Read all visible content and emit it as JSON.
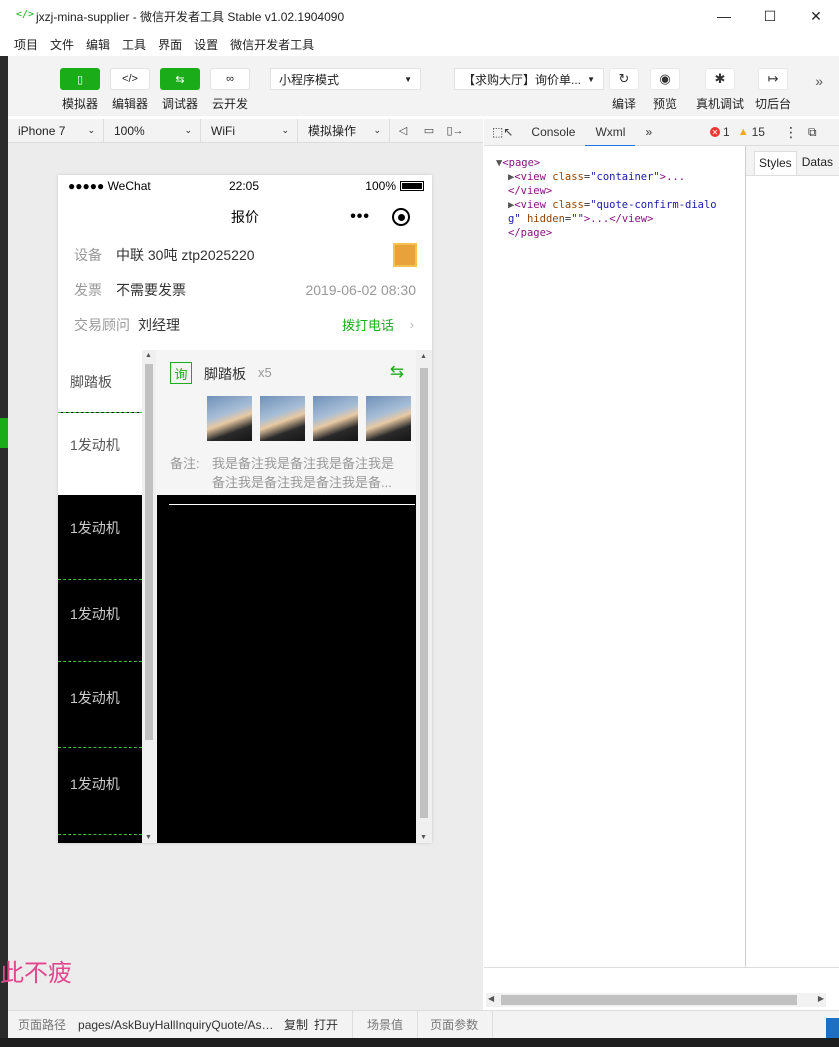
{
  "window": {
    "title": "jxzj-mina-supplier - 微信开发者工具 Stable v1.02.1904090",
    "minimize": "—",
    "maximize": "☐",
    "close": "✕"
  },
  "menu": [
    "项目",
    "文件",
    "编辑",
    "工具",
    "界面",
    "设置",
    "微信开发者工具"
  ],
  "toolbar": {
    "simulator": "模拟器",
    "editor": "编辑器",
    "debugger": "调试器",
    "cloud": "云开发",
    "mode_select": "小程序模式",
    "page_select": "【求购大厅】询价单...",
    "compile": "编译",
    "preview": "预览",
    "remote_debug": "真机调试",
    "background": "切后台",
    "more": "»"
  },
  "simbar": {
    "device": "iPhone 7",
    "zoom": "100%",
    "network": "WiFi",
    "operation": "模拟操作"
  },
  "phone": {
    "status_left": "●●●●● WeChat",
    "status_time": "22:05",
    "status_battery": "100%",
    "nav_title": "报价",
    "nav_dots": "•••",
    "rows": {
      "device_label": "设备",
      "device_value": "中联 30吨 ztp2025220",
      "invoice_label": "发票",
      "invoice_value": "不需要发票",
      "invoice_date": "2019-06-02 08:30",
      "advisor_label": "交易顾问",
      "advisor_value": "刘经理",
      "call": "拨打电话",
      "call_arrow": "›"
    },
    "categories": [
      "脚踏板",
      "1发动机",
      "1发动机",
      "1发动机",
      "1发动机",
      "1发动机"
    ],
    "card": {
      "tag": "询",
      "name": "脚踏板",
      "count": "x5",
      "swap_icon": "⇆",
      "remark_label": "备注:",
      "remark_line1": "我是备注我是备注我是备注我是",
      "remark_line2": "备注我是备注我是备注我是备..."
    }
  },
  "devtools": {
    "tab_console": "Console",
    "tab_wxml": "Wxml",
    "tab_more": "»",
    "errors": "1",
    "warnings": "15",
    "styles_tab": "Styles",
    "dataset_tab": "Datas",
    "wxml_lines": {
      "l1_open": "<page>",
      "l2_tag": "<view",
      "l2_attr": "class",
      "l2_val": "\"container\"",
      "l2_rest": ">...",
      "l3": "</view>",
      "l4_tag": "<view",
      "l4_attr": "class",
      "l4_val": "\"quote-confirm-dialo",
      "l5_val": "g\"",
      "l5_attr": "hidden",
      "l5_val2": "\"\"",
      "l5_rest": ">...</view>",
      "l6": "</page>"
    }
  },
  "footer": {
    "path_label": "页面路径",
    "path_value": "pages/AskBuyHallInquiryQuote/AskBuyHallInquiryQuote",
    "copy": "复制",
    "open": "打开",
    "scene": "场景值",
    "params": "页面参数"
  },
  "overlay_text": "此不疲",
  "colors": {
    "accent_green": "#1aad19",
    "error_red": "#e33333",
    "warning_orange": "#f5a623",
    "overlay_pink": "#e3468c"
  }
}
